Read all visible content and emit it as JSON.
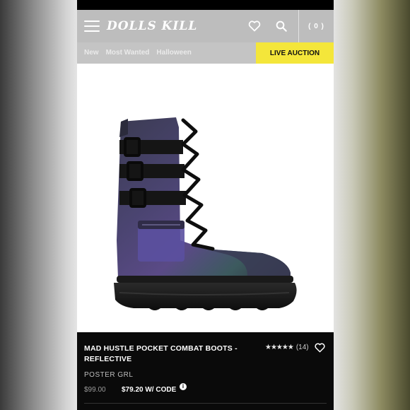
{
  "header": {
    "logo": "DOLLS KILL",
    "cart": "( 0 )",
    "icons": [
      "menu-icon",
      "heart-icon",
      "search-icon"
    ]
  },
  "nav": {
    "links": [
      "New",
      "Most Wanted",
      "Halloween"
    ],
    "live_auction": "LIVE AUCTION",
    "live_color": "#f4e63a"
  },
  "gallery": {
    "dots": 5,
    "active_index": 0
  },
  "product": {
    "title": "MAD HUSTLE POCKET COMBAT BOOTS - REFLECTIVE",
    "rating_stars": "★★★★★",
    "rating_count": "(14)",
    "brand": "POSTER GRL",
    "price_old": "$99.00",
    "price_new": "$79.20 W/ CODE"
  }
}
